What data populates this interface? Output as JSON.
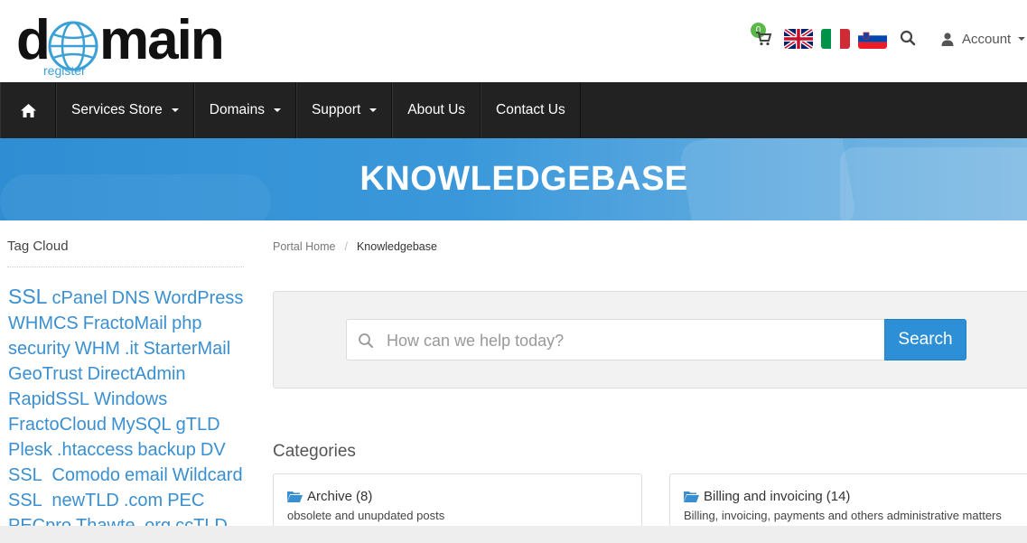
{
  "header": {
    "logo_main": "main",
    "logo_d": "d",
    "logo_sub": "register",
    "cart_count": "0",
    "account_label": "Account"
  },
  "nav": {
    "items": [
      {
        "label": "Services Store",
        "dropdown": true
      },
      {
        "label": "Domains",
        "dropdown": true
      },
      {
        "label": "Support",
        "dropdown": true
      },
      {
        "label": "About Us",
        "dropdown": false
      },
      {
        "label": "Contact Us",
        "dropdown": false
      }
    ]
  },
  "banner": {
    "title": "KNOWLEDGEBASE"
  },
  "sidebar": {
    "title": "Tag Cloud",
    "tags": [
      "SSL",
      "cPanel",
      "DNS",
      "WordPress",
      "WHMCS",
      "FractoMail",
      "php",
      "security",
      "WHM",
      ".it",
      "StarterMail",
      "GeoTrust",
      "DirectAdmin",
      "RapidSSL",
      "Windows",
      "FractoCloud",
      "MySQL",
      "gTLD",
      "Plesk",
      ".htaccess",
      "backup",
      "DV SSL",
      "Comodo",
      "email",
      "Wildcard SSL",
      "newTLD",
      ".com",
      "PEC",
      "PECpro",
      "Thawte",
      ".org",
      "ccTLD"
    ]
  },
  "breadcrumb": {
    "home": "Portal Home",
    "current": "Knowledgebase"
  },
  "search": {
    "placeholder": "How can we help today?",
    "button_label": "Search"
  },
  "categories": {
    "heading": "Categories",
    "items": [
      {
        "name": "Archive",
        "count": "(8)",
        "description": "obsolete and unupdated posts"
      },
      {
        "name": "Billing and invoicing",
        "count": "(14)",
        "description": "Billing, invoicing, payments and others administrative matters"
      }
    ]
  },
  "colors": {
    "accent": "#2d8fd6",
    "nav_bg": "#222222",
    "tag_link": "#3a8fd0",
    "badge": "#5ab849"
  }
}
